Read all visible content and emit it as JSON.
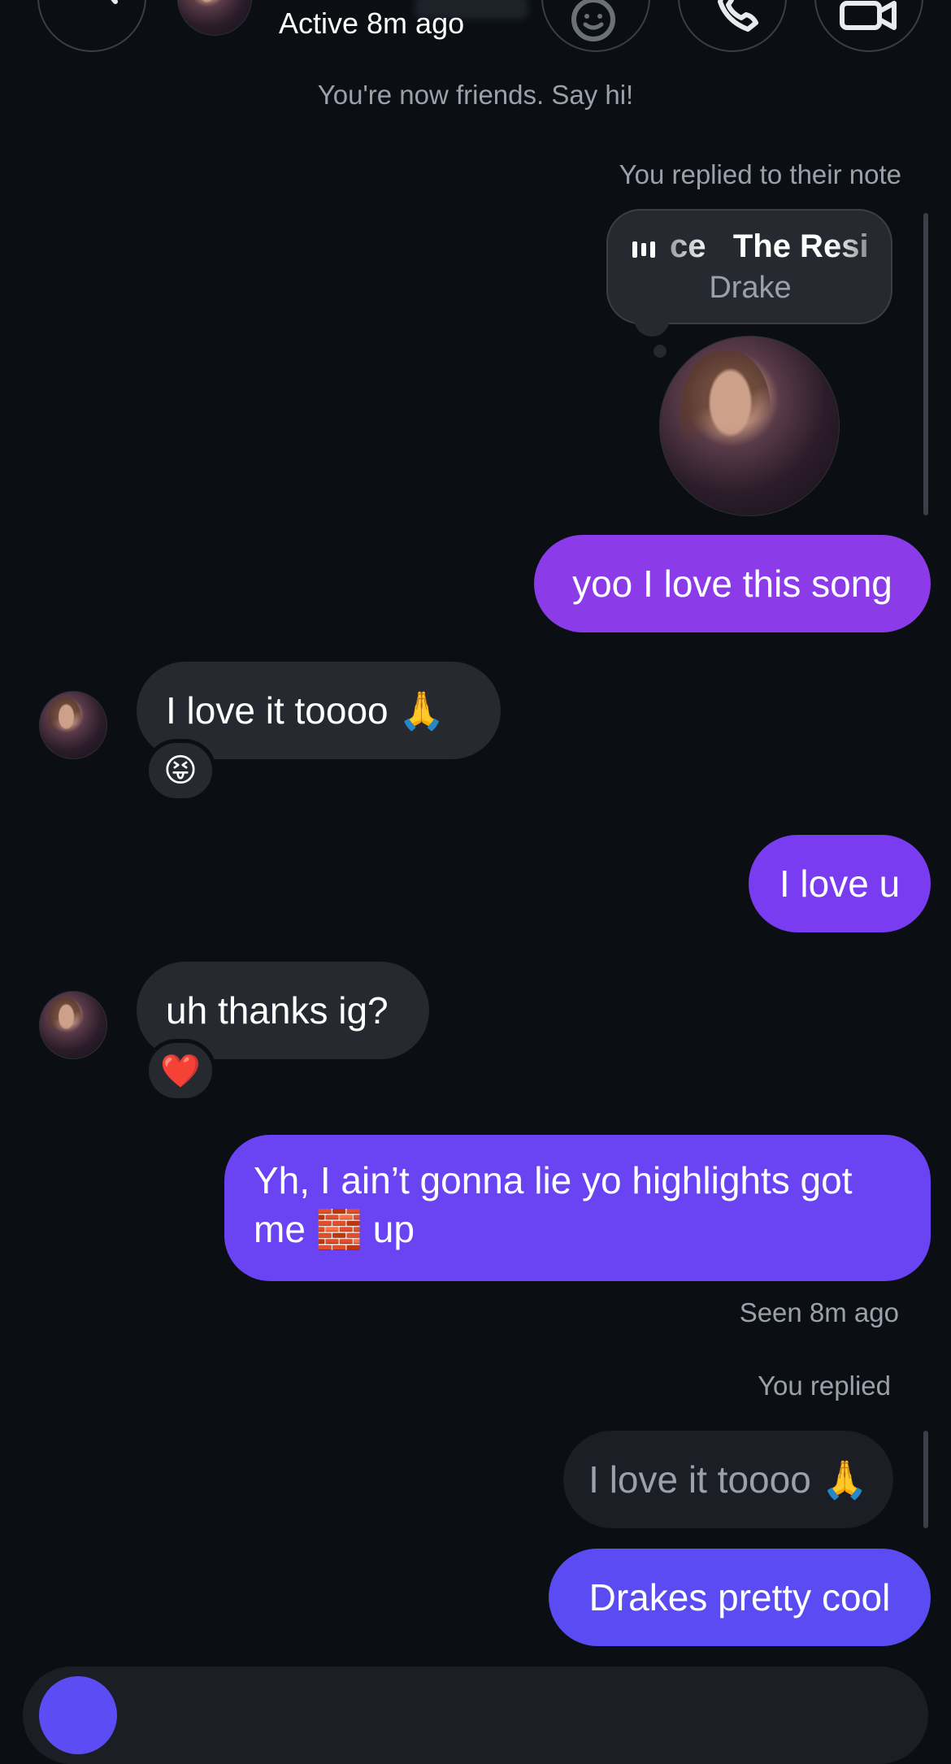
{
  "header": {
    "status": "Active 8m ago"
  },
  "system_message": "You're now friends. Say hi!",
  "note_reply": {
    "caption": "You replied to their note",
    "song_text": "ce   The Resi",
    "artist": "Drake"
  },
  "messages": [
    {
      "id": "m1",
      "text": "yoo I love this song"
    },
    {
      "id": "m2",
      "text": "I love it toooo 🙏",
      "reaction": "😝"
    },
    {
      "id": "m3",
      "text": "I love u"
    },
    {
      "id": "m4",
      "text": "uh thanks ig?",
      "reaction": "❤️"
    },
    {
      "id": "m5",
      "line1": "Yh, I ain’t gonna lie yo highlights got",
      "line2": "me 🧱 up"
    }
  ],
  "seen_status": "Seen 8m ago",
  "reply_block": {
    "caption": "You replied",
    "quoted": "I love it toooo 🙏",
    "text": "Drakes pretty cool"
  },
  "colors": {
    "background": "#0b0f14",
    "incoming_bubble": "#262a30",
    "outgoing_purple_1": "#8c3be8",
    "outgoing_purple_2": "#7a3cf0",
    "outgoing_purple_3": "#6a43f3",
    "outgoing_indigo": "#5a4cf2"
  },
  "icons": [
    "back-arrow-icon",
    "sticker-face-icon",
    "phone-icon",
    "video-camera-icon"
  ]
}
